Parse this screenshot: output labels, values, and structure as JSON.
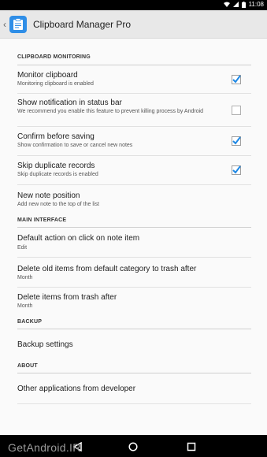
{
  "status": {
    "time": "11:08"
  },
  "app": {
    "title": "Clipboard Manager Pro",
    "accent": "#2f8ee7",
    "checkbox_color": "#1e88e5"
  },
  "sections": {
    "monitoring": "CLIPBOARD MONITORING",
    "main": "MAIN INTERFACE",
    "backup": "BACKUP",
    "about": "ABOUT"
  },
  "items": {
    "monitor": {
      "title": "Monitor clipboard",
      "summary": "Monitoring clipboard is enabled",
      "checked": true
    },
    "notification": {
      "title": "Show notification in status bar",
      "summary": "We recommend you enable this feature to prevent killing process by Android",
      "checked": false
    },
    "confirm": {
      "title": "Confirm before saving",
      "summary": "Show confirmation to save or cancel new notes",
      "checked": true
    },
    "skip": {
      "title": "Skip duplicate records",
      "summary": "Skip duplicate records is enabled",
      "checked": true
    },
    "position": {
      "title": "New note position",
      "summary": "Add new note to the top of the list"
    },
    "default_action": {
      "title": "Default action on click on note item",
      "summary": "Edit"
    },
    "delete_old": {
      "title": "Delete old items from default category to trash after",
      "summary": "Month"
    },
    "delete_trash": {
      "title": "Delete items from trash after",
      "summary": "Month"
    },
    "backup": {
      "title": "Backup settings"
    },
    "other_apps": {
      "title": "Other applications from developer"
    }
  },
  "watermark": "GetAndroid.IR"
}
